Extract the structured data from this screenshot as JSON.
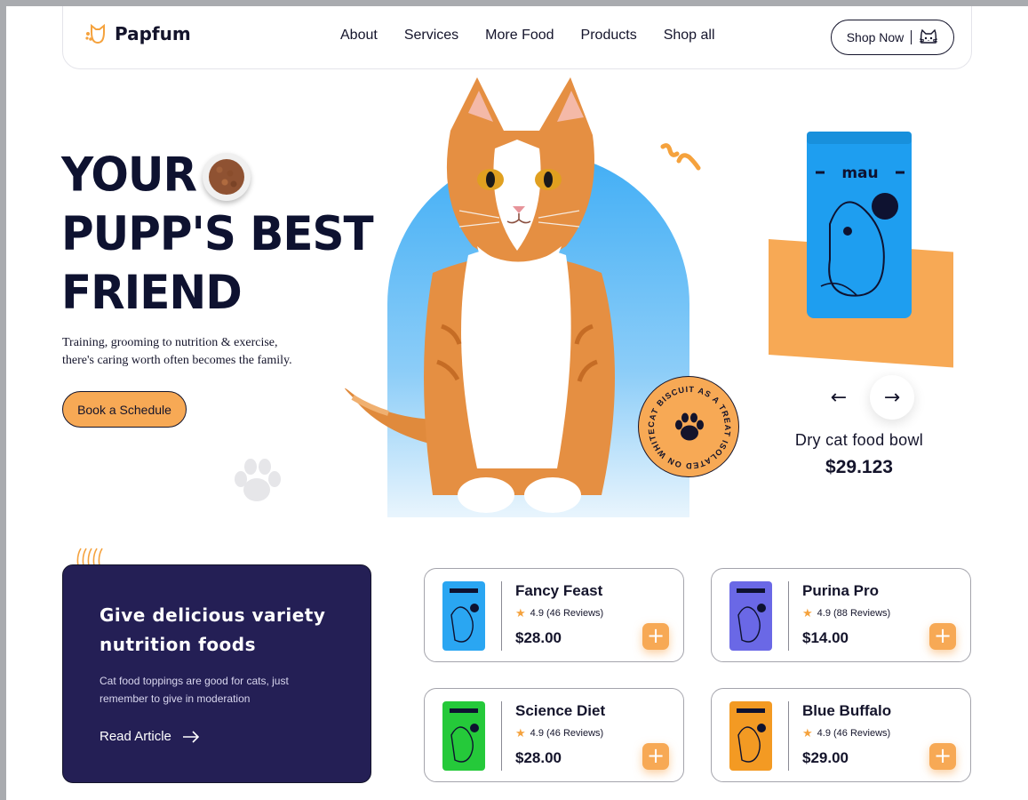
{
  "brand": {
    "name": "Papfum"
  },
  "nav": {
    "links": [
      "About",
      "Services",
      "More Food",
      "Products",
      "Shop all"
    ],
    "shop_button": "Shop Now"
  },
  "hero": {
    "title_lines": [
      "YOUR",
      "PUPP'S BEST",
      "FRIEND"
    ],
    "subtitle_line1": "Training, grooming to nutrition & exercise,",
    "subtitle_line2": "there's caring worth often becomes the family.",
    "cta": "Book a Schedule",
    "badge_text": "CAT BISCUIT AS A TREAT ISOLATED ON WHITE"
  },
  "featured": {
    "pouch_brand": "mau",
    "name": "Dry cat food bowl",
    "price": "$29.123"
  },
  "article": {
    "title_line1": "Give delicious variety",
    "title_line2": "nutrition  foods",
    "text": "Cat food toppings are good for cats, just remember to give in moderation",
    "link": "Read Article"
  },
  "products": [
    {
      "name": "Fancy Feast",
      "rating": "4.9 (46 Reviews)",
      "price": "$28.00",
      "color": "#2aa6f2"
    },
    {
      "name": "Purina Pro",
      "rating": "4.9 (88 Reviews)",
      "price": "$14.00",
      "color": "#6a68e6"
    },
    {
      "name": "Science Diet",
      "rating": "4.9 (46 Reviews)",
      "price": "$28.00",
      "color": "#25c93a"
    },
    {
      "name": "Blue Buffalo",
      "rating": "4.9 (46 Reviews)",
      "price": "$29.00",
      "color": "#f39a23"
    }
  ],
  "colors": {
    "accent": "#f7a955",
    "navy": "#241f55",
    "ink": "#14142b",
    "sky": "#41aef5"
  }
}
